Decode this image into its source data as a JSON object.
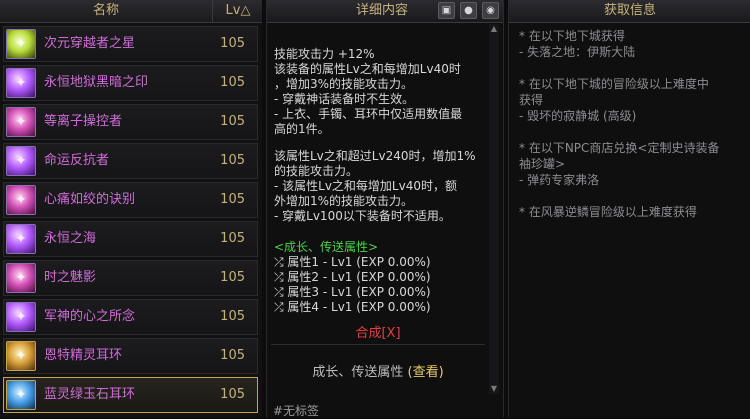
{
  "list": {
    "col_name": "名称",
    "col_lv": "Lv△",
    "items": [
      {
        "name": "次元穿越者之星",
        "lv": "105",
        "icon": "green"
      },
      {
        "name": "永恒地狱黑暗之印",
        "lv": "105",
        "icon": "violet"
      },
      {
        "name": "等离子操控者",
        "lv": "105",
        "icon": "pink"
      },
      {
        "name": "命运反抗者",
        "lv": "105",
        "icon": "violet"
      },
      {
        "name": "心痛如绞的诀别",
        "lv": "105",
        "icon": "pink"
      },
      {
        "name": "永恒之海",
        "lv": "105",
        "icon": "violet"
      },
      {
        "name": "时之魅影",
        "lv": "105",
        "icon": "pink"
      },
      {
        "name": "军神的心之所念",
        "lv": "105",
        "icon": "violet"
      },
      {
        "name": "恩特精灵耳环",
        "lv": "105",
        "icon": "gold"
      },
      {
        "name": "蓝灵绿玉石耳环",
        "lv": "105",
        "icon": "blue"
      }
    ],
    "selected_index": 9
  },
  "detail": {
    "title": "详细内容",
    "toolbar_icons": [
      "image-icon",
      "pin-icon",
      "eye-icon"
    ],
    "block1": "技能攻击力 +12%\n该装备的属性Lv之和每增加Lv40时\n，增加3%的技能攻击力。\n- 穿戴神话装备时不生效。\n- 上衣、手镯、耳环中仅适用数值最\n高的1件。",
    "block2": "该属性Lv之和超过Lv240时，增加1%\n的技能攻击力。\n- 该属性Lv之和每增加Lv40时，额\n外增加1%的技能攻击力。\n- 穿戴Lv100以下装备时不适用。",
    "growth_title": "<成长、传送属性>",
    "growth_lines": [
      "属性1 - Lv1 (EXP 0.00%)",
      "属性2 - Lv1 (EXP 0.00%)",
      "属性3 - Lv1 (EXP 0.00%)",
      "属性4 - Lv1 (EXP 0.00%)"
    ],
    "synth_label": "合成[X]",
    "transfer_label": "成长、传送属性",
    "transfer_link": "(查看)",
    "tag_label": "#无标签"
  },
  "acquire": {
    "title": "获取信息",
    "text": "* 在以下地下城获得\n- 失落之地：伊斯大陆\n\n* 在以下地下城的冒险级以上难度中\n获得\n- 毁坏的寂静城 (高级)\n\n* 在以下NPC商店兑换<定制史诗装备\n袖珍罐>\n- 弹药专家弗洛\n\n* 在风暴逆鳞冒险级以上难度获得"
  }
}
